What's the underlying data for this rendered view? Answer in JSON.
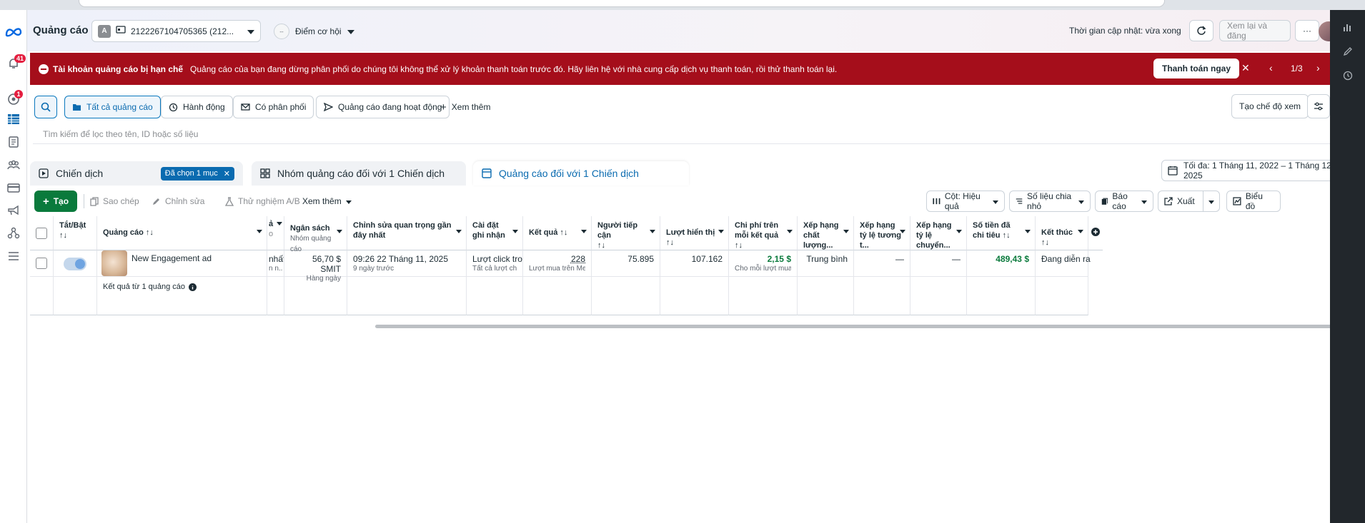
{
  "topbar": {
    "title": "Quảng cáo",
    "account_badge": "A",
    "account_label": "2122267104705365 (212...",
    "opportunity_label": "Điểm cơ hội",
    "opportunity_dot": "--",
    "updated_text": "Thời gian cập nhật: vừa xong",
    "review_publish_label": "Xem lại và đăng",
    "more_label": "···"
  },
  "leftnav": {
    "notifications_count": "41",
    "account_quality_count": "1"
  },
  "alert": {
    "title": "Tài khoản quảng cáo bị hạn chế",
    "message": "Quảng cáo của bạn đang dừng phân phối do chúng tôi không thể xử lý khoản thanh toán trước đó. Hãy liên hệ với nhà cung cấp dịch vụ thanh toán, rồi thử thanh toán lại.",
    "pay_now_label": "Thanh toán ngay",
    "pager": "1/3"
  },
  "filters": {
    "all_ads_label": "Tất cả quảng cáo",
    "actions_label": "Hành động",
    "delivering_label": "Có phân phối",
    "active_ads_label": "Quảng cáo đang hoạt động",
    "see_more_label": "Xem thêm",
    "create_view_label": "Tạo chế độ xem",
    "search_placeholder": "Tìm kiếm để lọc theo tên, ID hoặc số liệu"
  },
  "tabs": {
    "campaigns_label": "Chiến dịch",
    "selected_chip": "Đã chọn 1 mục",
    "adsets_label": "Nhóm quảng cáo đối với 1 Chiến dịch",
    "ads_label": "Quảng cáo đối với 1 Chiến dịch"
  },
  "date_range": "Tối đa: 1 Tháng 11, 2022 – 1 Tháng 12, 2025",
  "toolbar": {
    "create_label": "Tạo",
    "duplicate_label": "Sao chép",
    "edit_label": "Chỉnh sửa",
    "ab_test_label": "Thử nghiệm A/B",
    "more_label": "Xem thêm",
    "columns_label": "Cột: Hiệu quả",
    "breakdown_label": "Số liệu chia nhỏ",
    "reports_label": "Báo cáo",
    "export_label": "Xuất",
    "charts_label": "Biểu đồ"
  },
  "table": {
    "headers": {
      "toggle": "Tắt/Bật",
      "ad": "Quảng cáo",
      "budget": "Ngân sách",
      "budget_sub": "Nhóm quảng cáo",
      "last_edit": "Chỉnh sửa quan trọng gần đây nhất",
      "attribution": "Cài đặt ghi nhận",
      "results": "Kết quả",
      "reach": "Người tiếp cận",
      "impressions": "Lượt hiển thị",
      "cost_per_result": "Chi phí trên mỗi kết quả",
      "quality_rank": "Xếp hạng chất lượng...",
      "engagement_rank": "Xếp hạng tỷ lệ tương t...",
      "conversion_rank": "Xếp hạng tỷ lệ chuyển...",
      "amount_spent": "Số tiền đã chi tiêu",
      "ends": "Kết thúc",
      "clipped_a": "ả",
      "clipped_b": "o"
    },
    "row": {
      "name": "New Engagement ad",
      "clipped_main": "nhất",
      "clipped_sub": "n n...",
      "budget": "56,70 $ SMIT",
      "budget_sub": "Hàng ngày",
      "last_edit": "09:26 22 Tháng 11, 2025",
      "last_edit_sub": "9 ngày trước",
      "attribution": "Lượt click tro...",
      "attribution_sub": "Tất cả lượt chuyể...",
      "results": "228",
      "results_sub": "Lượt mua trên Meta",
      "reach": "75.895",
      "impressions": "107.162",
      "cost_per_result": "2,15 $",
      "cost_per_result_sub": "Cho mỗi lượt mua trê...",
      "quality_rank": "Trung bình",
      "engagement_rank": "—",
      "conversion_rank": "—",
      "amount_spent": "489,43 $",
      "ends": "Đang diễn ra"
    },
    "footer": "Kết quả từ 1 quảng cáo"
  }
}
